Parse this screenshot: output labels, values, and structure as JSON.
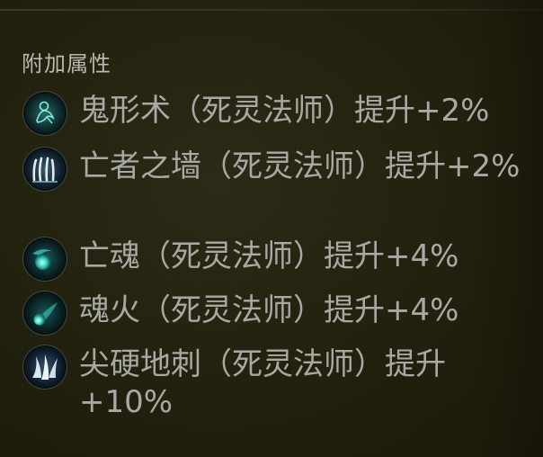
{
  "section_title": "附加属性",
  "attributes": [
    {
      "icon": "ghost-form-icon",
      "text": "鬼形术（死灵法师）提升+2%"
    },
    {
      "icon": "bone-wall-icon",
      "text": "亡者之墙（死灵法师）提升+2%"
    },
    {
      "icon": "soul-orb-icon",
      "text": "亡魂（死灵法师）提升+4%"
    },
    {
      "icon": "soulfire-icon",
      "text": "魂火（死灵法师）提升+4%"
    },
    {
      "icon": "bone-spikes-icon",
      "text": "尖硬地刺（死灵法师）提升+10%"
    }
  ],
  "colors": {
    "background": "#23220f",
    "text": "#a8a8a4",
    "icon_glow": "#3fd6c4"
  }
}
